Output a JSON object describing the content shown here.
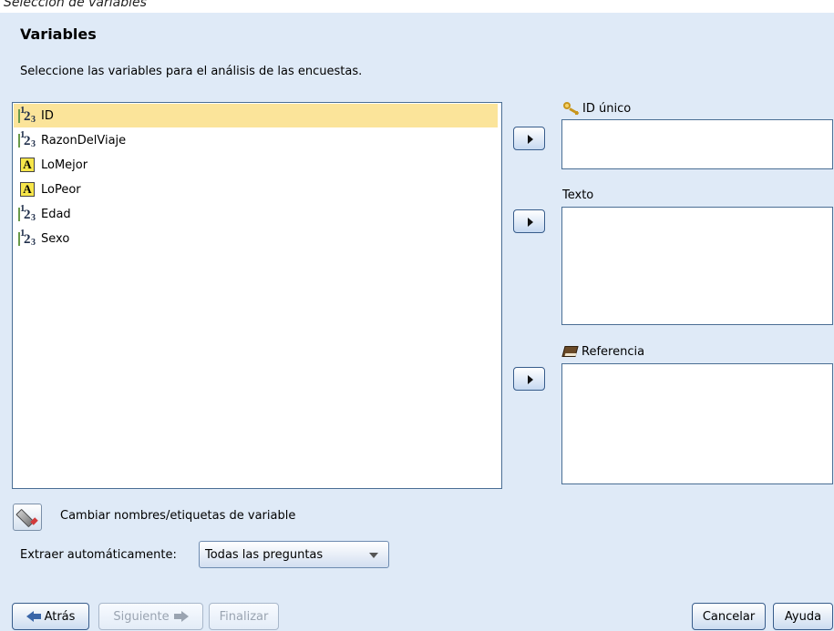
{
  "caption": "Selección de variables",
  "heading": "Variables",
  "subtitle": "Seleccione las variables para el análisis de las encuestas.",
  "variables": [
    {
      "name": "ID",
      "type": "numeric",
      "selected": true
    },
    {
      "name": "RazonDelViaje",
      "type": "numeric",
      "selected": false
    },
    {
      "name": "LoMejor",
      "type": "string",
      "selected": false
    },
    {
      "name": "LoPeor",
      "type": "string",
      "selected": false
    },
    {
      "name": "Edad",
      "type": "numeric",
      "selected": false
    },
    {
      "name": "Sexo",
      "type": "numeric",
      "selected": false
    }
  ],
  "icons": {
    "numeric_glyphs": [
      "1",
      "2",
      "3"
    ],
    "string_glyph": "A"
  },
  "targets": {
    "unique_id": {
      "label": "ID único",
      "icon": "key-icon"
    },
    "text": {
      "label": "Texto"
    },
    "reference": {
      "label": "Referencia",
      "icon": "book-icon"
    }
  },
  "rename": {
    "label": "Cambiar nombres/etiquetas de variable"
  },
  "extract": {
    "label": "Extraer automáticamente:",
    "selected": "Todas las preguntas"
  },
  "buttons": {
    "back": "Atrás",
    "next": "Siguiente",
    "finish": "Finalizar",
    "cancel": "Cancelar",
    "help": "Ayuda"
  }
}
